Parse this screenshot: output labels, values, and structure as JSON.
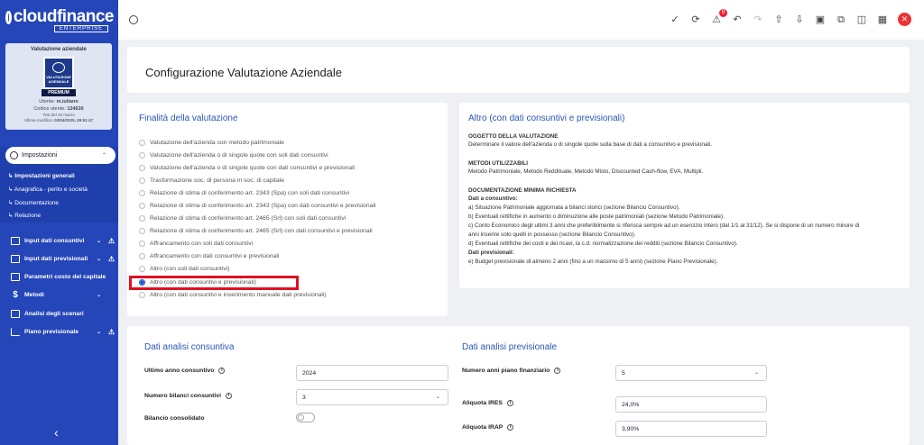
{
  "brand": {
    "name": "cloudfinance",
    "edition": "ENTERPRISE"
  },
  "company_card": {
    "title": "Valutazione aziendale",
    "badge_text": "VALUTAZIONE AZIENDALE",
    "badge_label": "PREMIUM",
    "user_label": "Utente:",
    "user_value": "m.iuliano",
    "code_label": "Codice utente:",
    "code_value": "124630",
    "test_line": "Test del 20 marzo",
    "modified_label": "Ultima modifica:",
    "modified_value": "03/04/2025, 09:51:47"
  },
  "sidebar": {
    "settings": {
      "label": "Impostazioni"
    },
    "sub_items": [
      {
        "label": "Impostazioni generali",
        "active": true
      },
      {
        "label": "Anagrafica - perito e società",
        "active": false
      },
      {
        "label": "Documentazione",
        "active": false
      },
      {
        "label": "Relazione",
        "active": false
      }
    ],
    "items": [
      {
        "label": "Input dati consuntivi",
        "icon": "edit-icon",
        "has_chevron": true,
        "warning": true
      },
      {
        "label": "Input dati previsionali",
        "icon": "edit-icon",
        "has_chevron": true,
        "warning": true
      },
      {
        "label": "Parametri costo del capitale",
        "icon": "edit-icon",
        "has_chevron": false,
        "warning": false
      },
      {
        "label": "Metodi",
        "icon": "dollar-icon",
        "has_chevron": true,
        "warning": false
      },
      {
        "label": "Analisi degli scenari",
        "icon": "book-icon",
        "has_chevron": false,
        "warning": false
      },
      {
        "label": "Piano previsionale",
        "icon": "bar-chart-icon",
        "has_chevron": true,
        "warning": true
      }
    ]
  },
  "topbar": {
    "notification_count": "8"
  },
  "page": {
    "title": "Configurazione Valutazione Aziendale"
  },
  "finalita": {
    "title": "Finalità della valutazione",
    "options": [
      {
        "label": "Valutazione dell'azienda con metodo patrimoniale",
        "selected": false
      },
      {
        "label": "Valutazione dell'azienda o di singole quote con soli dati consuntivi",
        "selected": false
      },
      {
        "label": "Valutazione dell'azienda o di singole quote con dati consuntivi e previsionali",
        "selected": false
      },
      {
        "label": "Trasformazione soc. di persona in soc. di capitale",
        "selected": false
      },
      {
        "label": "Relazione di stima di conferimento art. 2343 (Spa) con soli dati consuntivi",
        "selected": false
      },
      {
        "label": "Relazione di stima di conferimento art. 2343 (Spa) con dati consuntivi e previsionali",
        "selected": false
      },
      {
        "label": "Relazione di stima di conferimento art. 2465 (Srl) con soli dati consuntivi",
        "selected": false
      },
      {
        "label": "Relazione di stima di conferimento art. 2465 (Srl) con dati consuntivi e previsionali",
        "selected": false
      },
      {
        "label": "Affrancamento con soli dati consuntivi",
        "selected": false
      },
      {
        "label": "Affrancamento con dati consuntivi e previsionali",
        "selected": false
      },
      {
        "label": "Altro (con soli dati consuntivi)",
        "selected": false
      },
      {
        "label": "Altro (con dati consuntivi e previsionali)",
        "selected": true
      },
      {
        "label": "Altro (con dati consuntivi e inserimento manuale dati previsionali)",
        "selected": false
      }
    ]
  },
  "detail": {
    "title": "Altro (con dati consuntivi e previsionali)",
    "oggetto_heading": "OGGETTO DELLA VALUTAZIONE",
    "oggetto_text": "Determinare il valore dell'azienda o di singole quote sulla base di dati a consuntivo e previsionali.",
    "metodi_heading": "METODI UTILIZZABILI",
    "metodi_text": "Metodo Patrimoniale, Metodo Reddituale, Metodo Misto, Discounted Cash-flow, EVA, Multipli.",
    "doc_heading": "DOCUMENTAZIONE MINIMA RICHIESTA",
    "consuntivo_heading": "Dati a consuntivo:",
    "consuntivo_lines": [
      "a) Situazione Patrimoniale aggiornata a bilanci storici (sezione Bilancio Consuntivo).",
      "b) Eventuali rettifiche in aumento o diminuzione alle poste patrimoniali (sezione Metodo Patrimoniale).",
      "c) Conto Economico degli ultimi 3 anni che preferibilmente si riferisca sempre ad un esercizio intero (dal 1/1 al 31/12). Se si dispone di un numero minore di",
      "anni inserire solo quelli in possesso (sezione Bilancio Consuntivo).",
      "d) Eventuali rettifiche dei costi e dei ricavi, la c.d. normalizzazione dei redditi (sezione Bilancio Consuntivo)."
    ],
    "previsionali_heading": "Dati previsionali:",
    "previsionali_lines": [
      "e) Budget previsionale di almeno 2 anni (fino a un massimo di 5 anni) (sezione Piano Previsionale)."
    ]
  },
  "consuntiva": {
    "title": "Dati analisi consuntiva",
    "ultimo_anno_label": "Ultimo anno consuntivo",
    "ultimo_anno_value": "2024",
    "numero_bilanci_label": "Numero bilanci consuntivi",
    "numero_bilanci_value": "3",
    "consolidato_label": "Bilancio consolidato",
    "consolidato_on": false
  },
  "previsionale": {
    "title": "Dati analisi previsionale",
    "anni_piano_label": "Numero anni piano finanziario",
    "anni_piano_value": "5",
    "ires_label": "Aliquota IRES",
    "ires_value": "24,0%",
    "irap_label": "Aliquota IRAP",
    "irap_value": "3,90%"
  }
}
